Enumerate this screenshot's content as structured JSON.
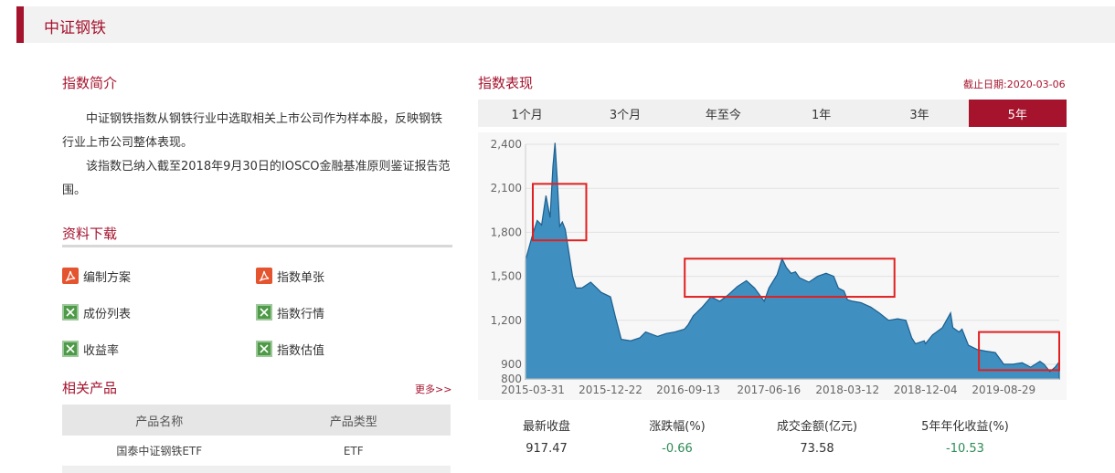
{
  "header": {
    "title": "中证钢铁"
  },
  "intro": {
    "title": "指数简介",
    "paragraphs": [
      "中证钢铁指数从钢铁行业中选取相关上市公司作为样本股，反映钢铁行业上市公司整体表现。",
      "该指数已纳入截至2018年9月30日的IOSCO金融基准原则鉴证报告范围。"
    ]
  },
  "downloads": {
    "title": "资料下载",
    "items": [
      {
        "label": "编制方案",
        "icon": "pdf-icon"
      },
      {
        "label": "指数单张",
        "icon": "pdf-icon"
      },
      {
        "label": "成份列表",
        "icon": "excel-icon"
      },
      {
        "label": "指数行情",
        "icon": "excel-icon"
      },
      {
        "label": "收益率",
        "icon": "excel-icon"
      },
      {
        "label": "指数估值",
        "icon": "excel-icon"
      }
    ]
  },
  "products": {
    "title": "相关产品",
    "more": "更多>>",
    "columns": [
      "产品名称",
      "产品类型"
    ],
    "rows": [
      [
        "国泰中证钢铁ETF",
        "ETF"
      ]
    ]
  },
  "performance": {
    "title": "指数表现",
    "as_of": "截止日期:2020-03-06",
    "tabs": [
      "1个月",
      "3个月",
      "年至今",
      "1年",
      "3年",
      "5年"
    ],
    "active_tab": "5年",
    "stats": [
      {
        "label": "最新收盘",
        "value": "917.47"
      },
      {
        "label": "涨跌幅(%)",
        "value": "-0.66"
      },
      {
        "label": "成交金额(亿元)",
        "value": "73.58"
      },
      {
        "label": "5年年化收益(%)",
        "value": "-10.53"
      }
    ]
  },
  "colors": {
    "accent": "#a5132d",
    "area": "#3f8fc0",
    "area_stroke": "#1c5f8f",
    "highlight_box": "#e02020",
    "negative": "#2e8b57"
  },
  "chart_data": {
    "type": "area",
    "title": "",
    "xlabel": "",
    "ylabel": "",
    "ylim": [
      800,
      2400
    ],
    "yticks": [
      800,
      900,
      1200,
      1500,
      1800,
      2100,
      2400
    ],
    "ytick_labels": [
      "800",
      "900",
      "1,200",
      "1,500",
      "1,800",
      "2,100",
      "2,400"
    ],
    "x_tick_labels": [
      "2015-03-31",
      "2015-12-22",
      "2016-09-13",
      "2017-06-16",
      "2018-03-12",
      "2018-12-04",
      "2019-08-29"
    ],
    "x": [
      "2015-03-06",
      "2015-03-31",
      "2015-04-15",
      "2015-04-30",
      "2015-05-15",
      "2015-05-29",
      "2015-06-08",
      "2015-06-15",
      "2015-06-23",
      "2015-07-01",
      "2015-07-10",
      "2015-07-20",
      "2015-07-31",
      "2015-08-14",
      "2015-08-26",
      "2015-09-15",
      "2015-10-15",
      "2015-11-05",
      "2015-11-20",
      "2015-12-22",
      "2016-01-08",
      "2016-01-28",
      "2016-02-29",
      "2016-03-31",
      "2016-04-20",
      "2016-05-31",
      "2016-06-30",
      "2016-07-29",
      "2016-08-31",
      "2016-09-13",
      "2016-09-30",
      "2016-10-31",
      "2016-11-30",
      "2016-12-30",
      "2017-01-26",
      "2017-02-28",
      "2017-03-31",
      "2017-04-28",
      "2017-05-31",
      "2017-06-16",
      "2017-07-14",
      "2017-07-31",
      "2017-08-15",
      "2017-08-31",
      "2017-09-15",
      "2017-09-29",
      "2017-10-31",
      "2017-11-30",
      "2017-12-29",
      "2018-01-24",
      "2018-02-09",
      "2018-02-28",
      "2018-03-12",
      "2018-03-30",
      "2018-04-27",
      "2018-05-31",
      "2018-06-29",
      "2018-07-31",
      "2018-08-31",
      "2018-09-28",
      "2018-10-18",
      "2018-10-31",
      "2018-11-30",
      "2018-12-04",
      "2018-12-28",
      "2019-01-31",
      "2019-02-28",
      "2019-03-08",
      "2019-03-29",
      "2019-04-08",
      "2019-04-30",
      "2019-05-31",
      "2019-06-28",
      "2019-07-31",
      "2019-08-29",
      "2019-09-30",
      "2019-10-31",
      "2019-11-29",
      "2019-12-31",
      "2020-01-14",
      "2020-02-03",
      "2020-02-21",
      "2020-03-06"
    ],
    "series": [
      {
        "values": [
          1610,
          1790,
          1880,
          1850,
          2050,
          1900,
          2250,
          2410,
          2150,
          1840,
          1870,
          1820,
          1680,
          1500,
          1420,
          1420,
          1460,
          1420,
          1390,
          1360,
          1220,
          1070,
          1060,
          1080,
          1120,
          1090,
          1110,
          1120,
          1140,
          1170,
          1230,
          1290,
          1360,
          1330,
          1370,
          1430,
          1470,
          1420,
          1330,
          1420,
          1510,
          1620,
          1560,
          1520,
          1530,
          1490,
          1460,
          1500,
          1520,
          1500,
          1420,
          1400,
          1340,
          1330,
          1320,
          1290,
          1250,
          1200,
          1210,
          1200,
          1080,
          1040,
          1060,
          1040,
          1100,
          1150,
          1250,
          1150,
          1120,
          1140,
          1030,
          1000,
          990,
          980,
          900,
          900,
          910,
          880,
          920,
          900,
          850,
          880,
          917
        ]
      }
    ]
  }
}
